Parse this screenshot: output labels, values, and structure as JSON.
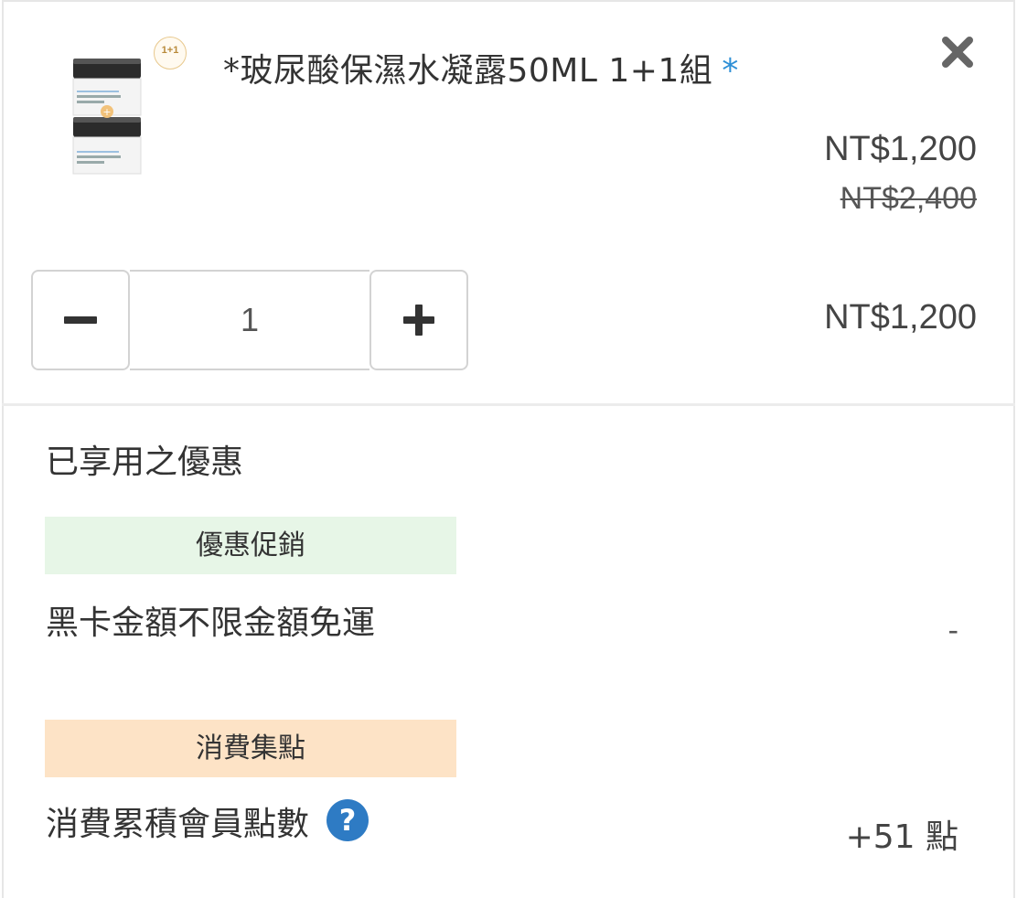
{
  "product": {
    "title": "*玻尿酸保濕水凝露50ML 1+1組",
    "required_mark": "*",
    "badge_text": "1+1",
    "image_label": "INTENSIVE HYDRATING GEL",
    "price_sale": "NT$1,200",
    "price_original": "NT$2,400",
    "quantity": "1",
    "line_total": "NT$1,200",
    "icons": {
      "remove": "close-icon",
      "decrease": "minus-icon",
      "increase": "plus-icon"
    }
  },
  "promotions": {
    "heading": "已享用之優惠",
    "discount_tag": "優惠促銷",
    "discount_name": "黑卡金額不限金額免運",
    "discount_value": "-",
    "points_tag": "消費集點",
    "points_name": "消費累積會員點數",
    "points_value": "+51 點",
    "help_icon": "question-circle-icon"
  },
  "colors": {
    "accent_blue": "#2e8fd6",
    "discount_tag_bg": "#e7f6e7",
    "points_tag_bg": "#fde3c6",
    "help_icon": "#2e7bc4"
  }
}
